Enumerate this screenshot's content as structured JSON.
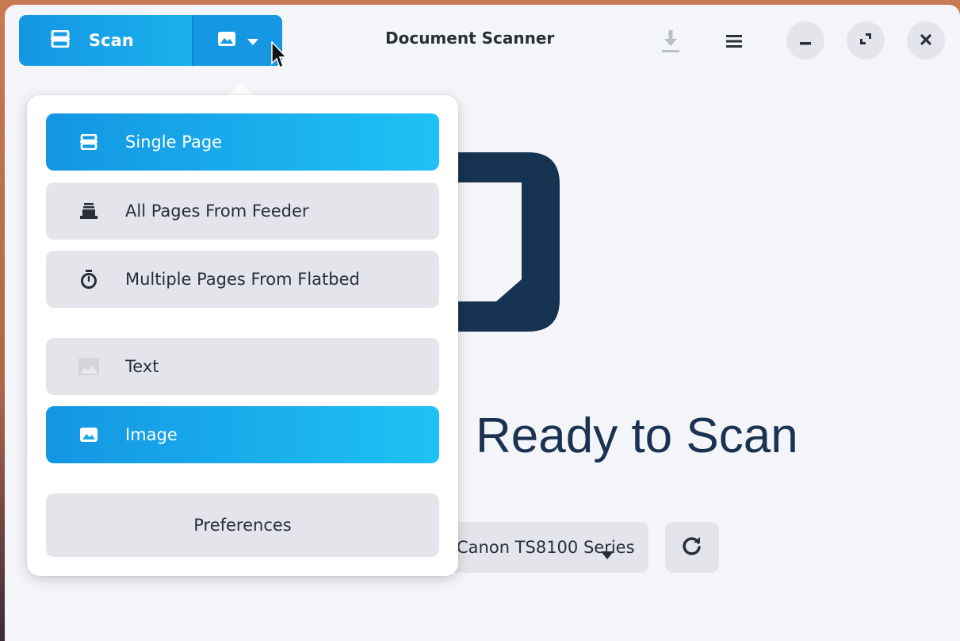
{
  "header": {
    "scan_label": "Scan",
    "title": "Document Scanner"
  },
  "main": {
    "ready_text": "Ready to Scan",
    "device_label": "Canon TS8100 Series"
  },
  "menu": {
    "single_page": "Single Page",
    "all_pages_feeder": "All Pages From Feeder",
    "multiple_pages_flatbed": "Multiple Pages From Flatbed",
    "text": "Text",
    "image": "Image",
    "preferences": "Preferences"
  },
  "colors": {
    "accent_start": "#1396e3",
    "accent_end": "#1fc2f4",
    "icon_dark": "#163352"
  }
}
